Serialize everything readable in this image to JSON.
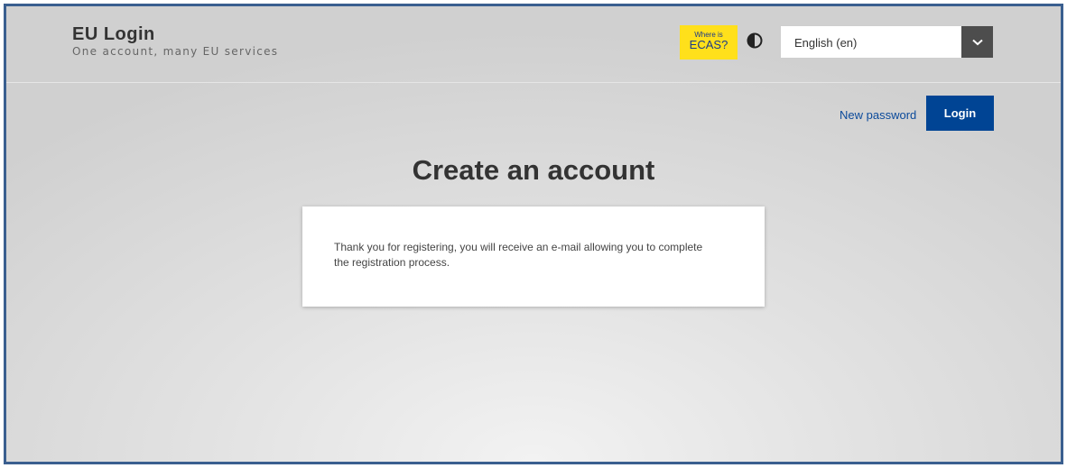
{
  "header": {
    "title": "EU Login",
    "subtitle": "One account, many EU services",
    "ecas_badge": {
      "line1": "Where is",
      "line2": "ECAS?"
    },
    "contrast_icon": "contrast-icon",
    "language_select": {
      "value": "English (en)",
      "arrow_icon": "chevron-down-icon"
    }
  },
  "nav": {
    "new_password_label": "New password",
    "login_label": "Login"
  },
  "main": {
    "title": "Create an account",
    "message": "Thank you for registering, you will receive an e-mail allowing you to complete the registration process."
  },
  "colors": {
    "frame_border": "#3a5f8f",
    "ecas_yellow": "#ffe01b",
    "primary_blue": "#004494",
    "link_blue": "#0b4a9b"
  }
}
